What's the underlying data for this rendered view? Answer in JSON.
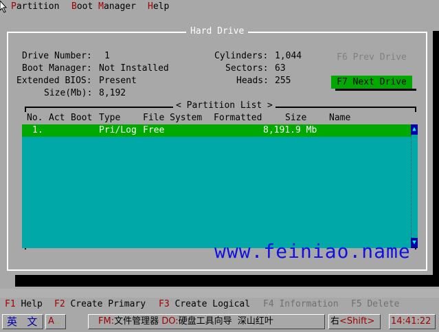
{
  "menu": {
    "items": [
      {
        "hotkey": "P",
        "rest": "artition"
      },
      {
        "hotkey": "B",
        "rest": "oot "
      },
      {
        "hotkey": "M",
        "rest": "anager"
      },
      {
        "hotkey": "H",
        "rest": "elp"
      }
    ]
  },
  "dialog": {
    "title": "Hard Drive",
    "info": {
      "drive_number_label": "Drive Number:",
      "drive_number_value": "1",
      "boot_manager_label": "Boot Manager:",
      "boot_manager_value": "Not Installed",
      "ext_bios_label": "Extended BIOS:",
      "ext_bios_value": "Present",
      "size_label": "Size(Mb):",
      "size_value": "8,192",
      "cylinders_label": "Cylinders:",
      "cylinders_value": "1,044",
      "sectors_label": "Sectors:",
      "sectors_value": "63",
      "heads_label": "Heads:",
      "heads_value": "255"
    },
    "buttons": {
      "prev": "F6 Prev Drive",
      "next": "F7 Next Drive"
    }
  },
  "partition_list": {
    "title": "< Partition List >",
    "columns": [
      "No.",
      "Act",
      "Boot",
      "Type",
      "File System",
      "Formatted",
      "Size",
      "Name"
    ],
    "rows": [
      {
        "no": "1.",
        "act": "",
        "boot": "",
        "type": "Pri/Log",
        "fs": "Free",
        "formatted": "",
        "size": "8,191.9 Mb",
        "name": ""
      }
    ],
    "scroll_up": "▲",
    "scroll_down": "▼"
  },
  "watermark": "www.feiniao.name",
  "fkeys": [
    {
      "key": "F1",
      "label": " Help",
      "enabled": true
    },
    {
      "key": "F2",
      "label": " Create Primary",
      "enabled": true
    },
    {
      "key": "F3",
      "label": " Create Logical",
      "enabled": true
    },
    {
      "key": "F4",
      "label": " Information",
      "enabled": false
    },
    {
      "key": "F5",
      "label": " Delete",
      "enabled": false
    }
  ],
  "statusbar": {
    "lang": "英",
    "mode": "文",
    "input": "A",
    "dots": "..",
    "fm_key": "FM:",
    "fm_label": "文件管理器",
    "do_key": "DO:",
    "do_label": "硬盘工具向导",
    "extra": "深山红叶",
    "right": "右",
    "shift": "<Shift>",
    "time": "14:41:22"
  },
  "colors": {
    "bg": "#a8a8a8",
    "list_bg": "#00a8a8",
    "highlight": "#00a800",
    "hotkey": "#a00000",
    "watermark": "#1010e0"
  }
}
